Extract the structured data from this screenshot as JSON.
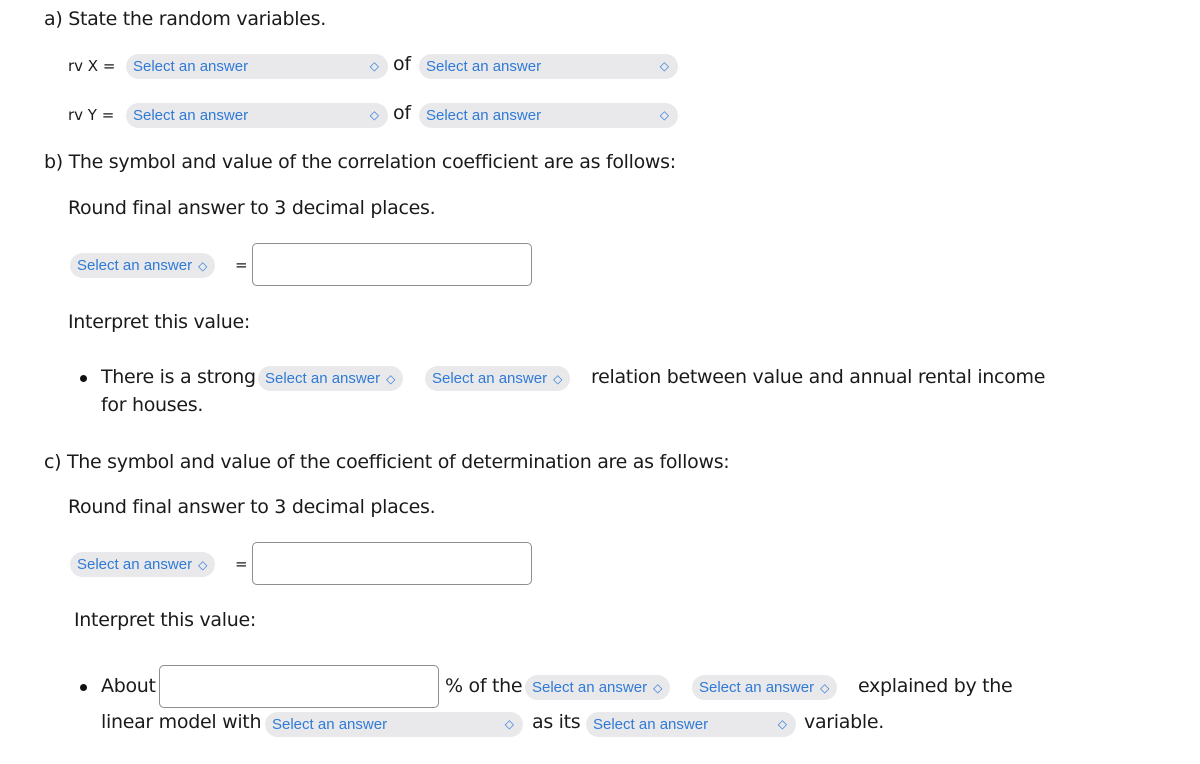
{
  "part_a": {
    "heading": "a) State the random variables.",
    "rows": [
      {
        "label": "rv X =",
        "of": "of",
        "select1": "Select an answer",
        "select2": "Select an answer"
      },
      {
        "label": "rv Y =",
        "of": "of",
        "select1": "Select an answer",
        "select2": "Select an answer"
      }
    ]
  },
  "part_b": {
    "heading": "b) The symbol and value of the correlation coefficient are as follows:",
    "round_note": "Round final answer to 3 decimal places.",
    "symbol_select": "Select an answer",
    "equals": "=",
    "value_input": "",
    "interpret_label": "Interpret this value:",
    "sentence": {
      "prefix": "There is a strong",
      "select1": "Select an answer",
      "select2": "Select an answer",
      "suffix": "relation between value and annual rental income",
      "continuation": "for houses."
    }
  },
  "part_c": {
    "heading": "c) The symbol and value of the coefficient of determination are as follows:",
    "round_note": "Round final answer to 3 decimal places.",
    "symbol_select": "Select an answer",
    "equals": "=",
    "value_input": "",
    "interpret_label": "Interpret this value:",
    "sentence": {
      "prefix": "About",
      "percent_input": "",
      "after_input": "% of the",
      "select1": "Select an answer",
      "select2": "Select an answer",
      "after_selects": "explained by the",
      "line2_prefix": "linear model with",
      "select3": "Select an answer",
      "as_its": "as its",
      "select4": "Select an answer",
      "end": "variable."
    }
  },
  "icons": {
    "select_chevron": "⬍"
  }
}
